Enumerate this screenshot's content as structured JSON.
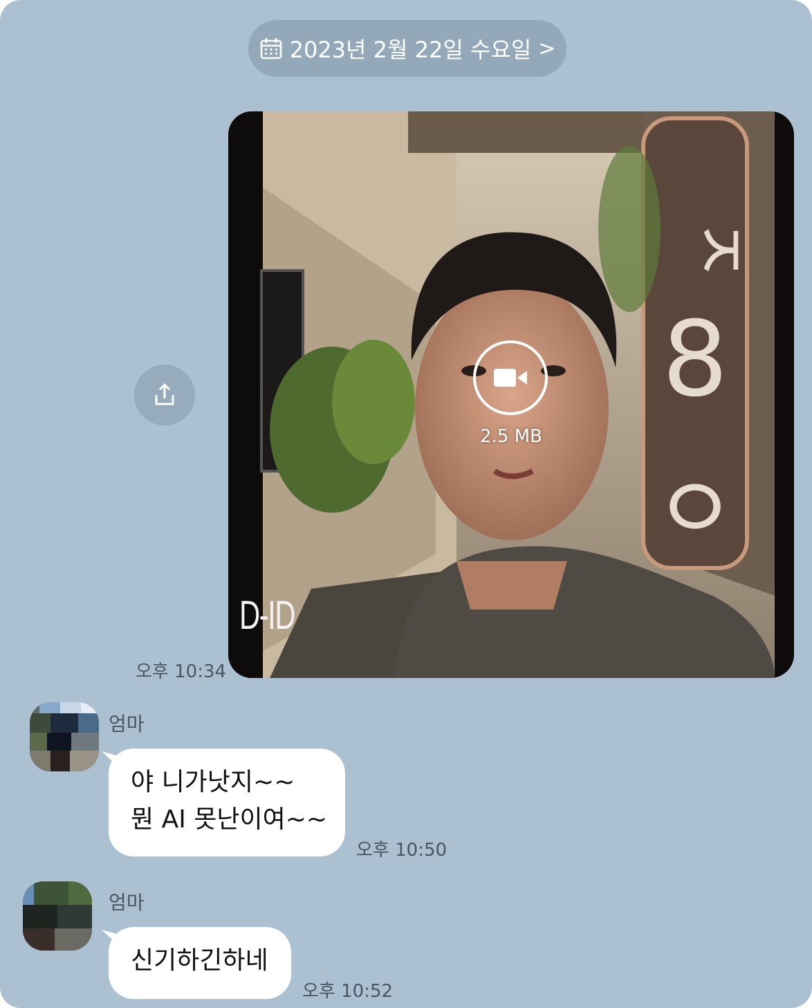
{
  "date_header": {
    "label": "2023년 2월 22일 수요일",
    "chevron": ">",
    "icon": "calendar-icon"
  },
  "share": {
    "icon": "share-icon"
  },
  "video_message": {
    "file_size": "2.5 MB",
    "watermark": "D-ID",
    "icon": "video-camera-icon",
    "time": "오후 10:34"
  },
  "messages": [
    {
      "sender": "엄마",
      "lines": [
        "야 니가낫지~~",
        "뭔 AI 못난이여~~"
      ],
      "time": "오후 10:50"
    },
    {
      "sender": "엄마",
      "lines": [
        "신기하긴하네"
      ],
      "time": "오후 10:52"
    }
  ],
  "colors": {
    "chat_background": "#abc1d1",
    "pill_background": "#93a9b9",
    "bubble_background": "#ffffff",
    "timestamp_text": "#4a5661"
  }
}
